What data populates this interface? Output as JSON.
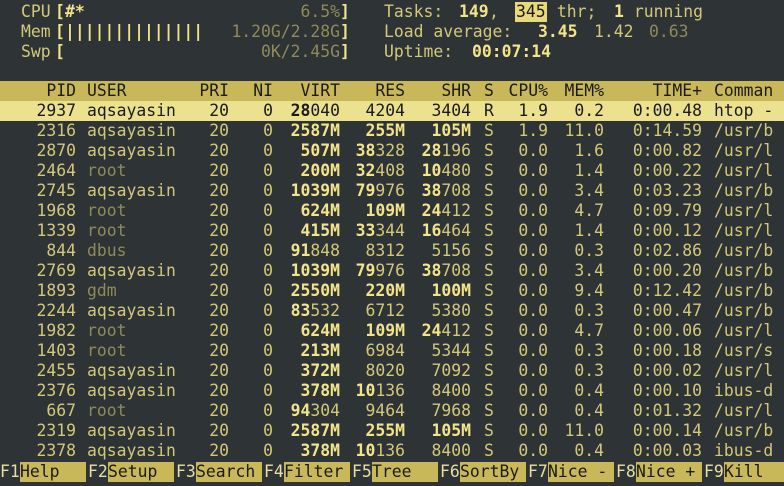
{
  "meters": {
    "cpu": {
      "label": "CPU",
      "open": "[",
      "bar": "#*",
      "value": "6.5%",
      "close": "]"
    },
    "mem": {
      "label": "Mem",
      "open": "[",
      "bar": "||||||||||||||",
      "value": "1.20G/2.28G",
      "close": "]"
    },
    "swp": {
      "label": "Swp",
      "open": "[",
      "bar": "",
      "value": "0K/2.45G",
      "close": "]"
    }
  },
  "stats": {
    "tasks_label": "Tasks: ",
    "tasks": "149",
    "tasks_sep": ", ",
    "threads": "345",
    "threads_label": " thr; ",
    "running": "1",
    "running_label": " running",
    "load_label": "Load average: ",
    "load1": "3.45",
    "load5": "1.42",
    "load15": "0.63",
    "uptime_label": "Uptime: ",
    "uptime": "00:07:14"
  },
  "columns": [
    "PID",
    "USER",
    "PRI",
    "NI",
    "VIRT",
    "RES",
    "SHR",
    "S",
    "CPU%",
    "MEM%",
    "TIME+",
    "Comman"
  ],
  "processes": [
    {
      "pid": "2937",
      "user": "aqsayasin",
      "pri": "20",
      "ni": "0",
      "virt": "28040",
      "res": "4204",
      "shr": "3404",
      "s": "R",
      "cpu": "1.9",
      "mem": "0.2",
      "time": "0:00.48",
      "cmd": "htop -",
      "selected": true
    },
    {
      "pid": "2316",
      "user": "aqsayasin",
      "pri": "20",
      "ni": "0",
      "virt": "2587M",
      "res": "255M",
      "shr": "105M",
      "s": "S",
      "cpu": "1.9",
      "mem": "11.0",
      "time": "0:14.59",
      "cmd": "/usr/b"
    },
    {
      "pid": "2870",
      "user": "aqsayasin",
      "pri": "20",
      "ni": "0",
      "virt": "507M",
      "res": "38328",
      "shr": "28196",
      "s": "S",
      "cpu": "0.0",
      "mem": "1.6",
      "time": "0:00.82",
      "cmd": "/usr/l"
    },
    {
      "pid": "2464",
      "user": "root",
      "pri": "20",
      "ni": "0",
      "virt": "200M",
      "res": "32408",
      "shr": "10480",
      "s": "S",
      "cpu": "0.0",
      "mem": "1.4",
      "time": "0:00.22",
      "cmd": "/usr/l"
    },
    {
      "pid": "2745",
      "user": "aqsayasin",
      "pri": "20",
      "ni": "0",
      "virt": "1039M",
      "res": "79976",
      "shr": "38708",
      "s": "S",
      "cpu": "0.0",
      "mem": "3.4",
      "time": "0:03.23",
      "cmd": "/usr/b"
    },
    {
      "pid": "1968",
      "user": "root",
      "pri": "20",
      "ni": "0",
      "virt": "624M",
      "res": "109M",
      "shr": "24412",
      "s": "S",
      "cpu": "0.0",
      "mem": "4.7",
      "time": "0:09.79",
      "cmd": "/usr/l"
    },
    {
      "pid": "1339",
      "user": "root",
      "pri": "20",
      "ni": "0",
      "virt": "415M",
      "res": "33344",
      "shr": "16464",
      "s": "S",
      "cpu": "0.0",
      "mem": "1.4",
      "time": "0:00.12",
      "cmd": "/usr/l"
    },
    {
      "pid": "844",
      "user": "dbus",
      "pri": "20",
      "ni": "0",
      "virt": "91848",
      "res": "8312",
      "shr": "5156",
      "s": "S",
      "cpu": "0.0",
      "mem": "0.3",
      "time": "0:02.86",
      "cmd": "/usr/b"
    },
    {
      "pid": "2769",
      "user": "aqsayasin",
      "pri": "20",
      "ni": "0",
      "virt": "1039M",
      "res": "79976",
      "shr": "38708",
      "s": "S",
      "cpu": "0.0",
      "mem": "3.4",
      "time": "0:00.20",
      "cmd": "/usr/b"
    },
    {
      "pid": "1893",
      "user": "gdm",
      "pri": "20",
      "ni": "0",
      "virt": "2550M",
      "res": "220M",
      "shr": "100M",
      "s": "S",
      "cpu": "0.0",
      "mem": "9.4",
      "time": "0:12.42",
      "cmd": "/usr/b"
    },
    {
      "pid": "2244",
      "user": "aqsayasin",
      "pri": "20",
      "ni": "0",
      "virt": "83532",
      "res": "6712",
      "shr": "5380",
      "s": "S",
      "cpu": "0.0",
      "mem": "0.3",
      "time": "0:00.47",
      "cmd": "/usr/b"
    },
    {
      "pid": "1982",
      "user": "root",
      "pri": "20",
      "ni": "0",
      "virt": "624M",
      "res": "109M",
      "shr": "24412",
      "s": "S",
      "cpu": "0.0",
      "mem": "4.7",
      "time": "0:00.06",
      "cmd": "/usr/l"
    },
    {
      "pid": "1403",
      "user": "root",
      "pri": "20",
      "ni": "0",
      "virt": "213M",
      "res": "6984",
      "shr": "5344",
      "s": "S",
      "cpu": "0.0",
      "mem": "0.3",
      "time": "0:00.18",
      "cmd": "/usr/s"
    },
    {
      "pid": "2455",
      "user": "aqsayasin",
      "pri": "20",
      "ni": "0",
      "virt": "372M",
      "res": "8020",
      "shr": "7092",
      "s": "S",
      "cpu": "0.0",
      "mem": "0.3",
      "time": "0:00.02",
      "cmd": "/usr/l"
    },
    {
      "pid": "2376",
      "user": "aqsayasin",
      "pri": "20",
      "ni": "0",
      "virt": "378M",
      "res": "10136",
      "shr": "8400",
      "s": "S",
      "cpu": "0.0",
      "mem": "0.4",
      "time": "0:00.10",
      "cmd": "ibus-d"
    },
    {
      "pid": "667",
      "user": "root",
      "pri": "20",
      "ni": "0",
      "virt": "94304",
      "res": "9464",
      "shr": "7968",
      "s": "S",
      "cpu": "0.0",
      "mem": "0.4",
      "time": "0:01.32",
      "cmd": "/usr/l"
    },
    {
      "pid": "2319",
      "user": "aqsayasin",
      "pri": "20",
      "ni": "0",
      "virt": "2587M",
      "res": "255M",
      "shr": "105M",
      "s": "S",
      "cpu": "0.0",
      "mem": "11.0",
      "time": "0:00.14",
      "cmd": "/usr/b"
    },
    {
      "pid": "2378",
      "user": "aqsayasin",
      "pri": "20",
      "ni": "0",
      "virt": "378M",
      "res": "10136",
      "shr": "8400",
      "s": "S",
      "cpu": "0.0",
      "mem": "0.4",
      "time": "0:00.03",
      "cmd": "ibus-d"
    }
  ],
  "function_keys": [
    {
      "key": "F1",
      "label": "Help  "
    },
    {
      "key": "F2",
      "label": "Setup "
    },
    {
      "key": "F3",
      "label": "Search"
    },
    {
      "key": "F4",
      "label": "Filter"
    },
    {
      "key": "F5",
      "label": "Tree  "
    },
    {
      "key": "F6",
      "label": "SortBy"
    },
    {
      "key": "F7",
      "label": "Nice -"
    },
    {
      "key": "F8",
      "label": "Nice +"
    },
    {
      "key": "F9",
      "label": "Kill  "
    }
  ],
  "colors": {
    "background": "#2e3436",
    "text": "#d3c77a",
    "header_bar": "#c9b85a",
    "selected_row": "#ece18e"
  }
}
